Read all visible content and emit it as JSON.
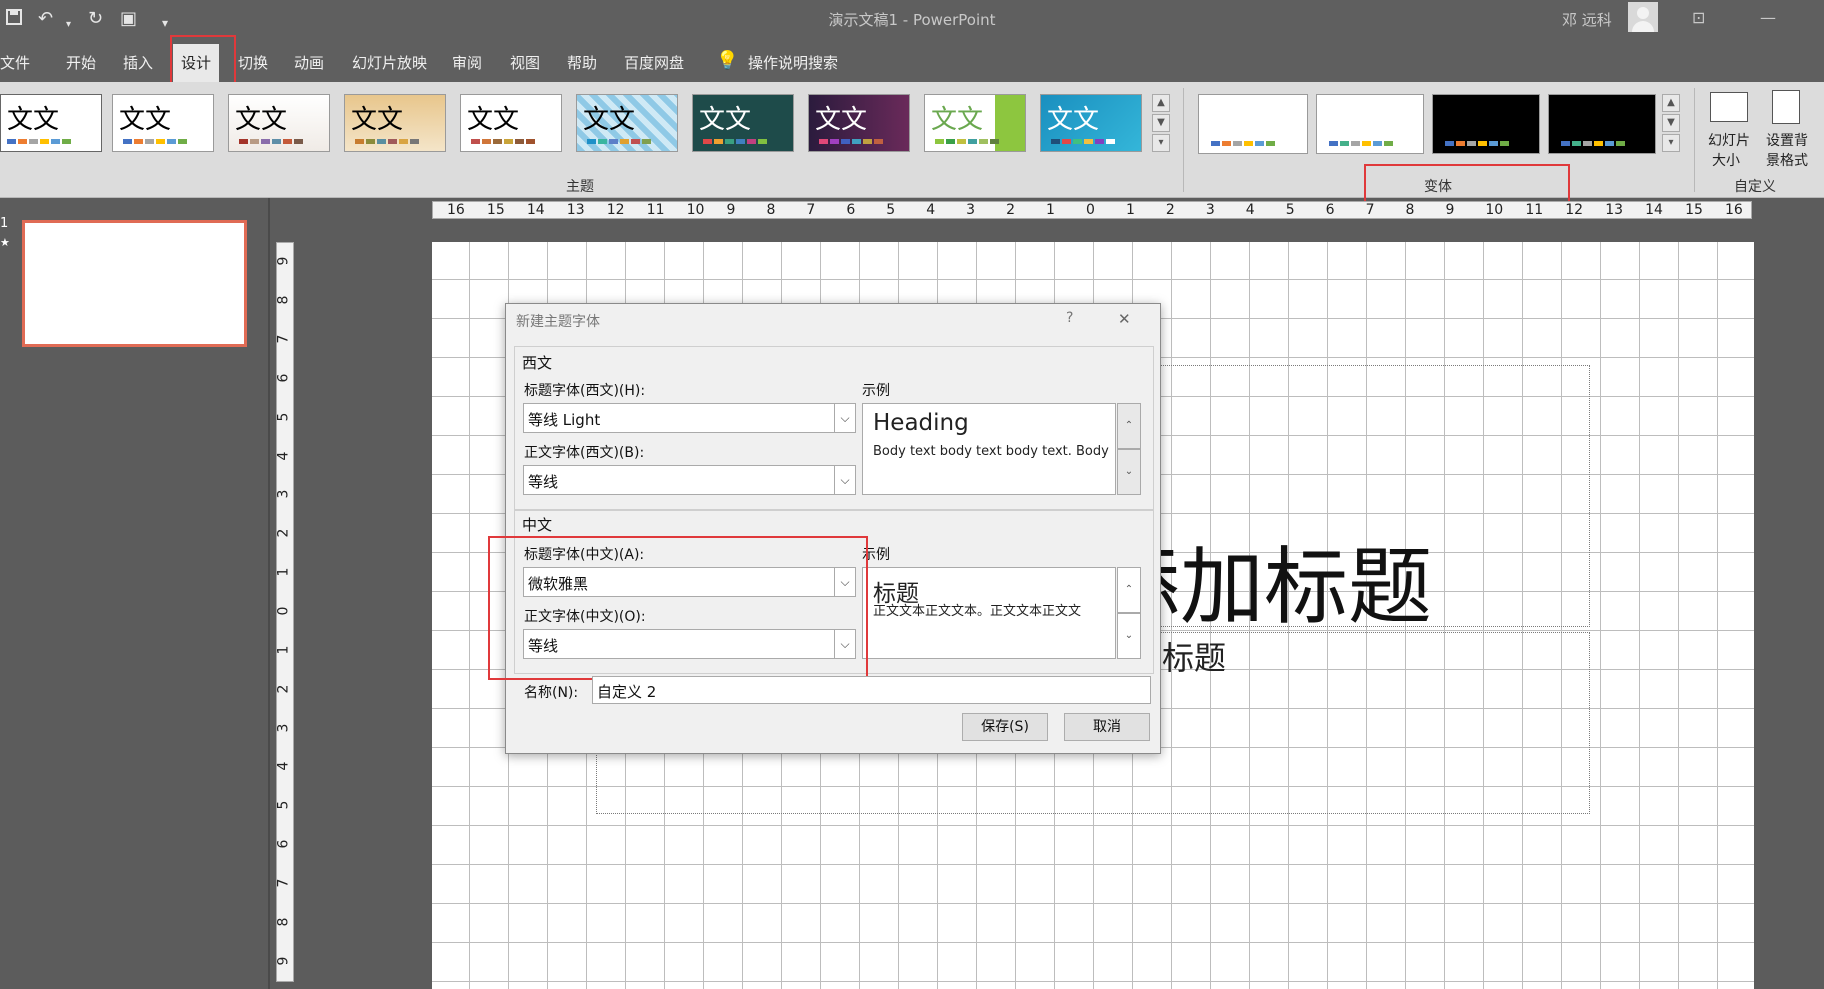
{
  "window": {
    "title": "演示文稿1  -  PowerPoint",
    "user_name": "邓 远科"
  },
  "menu": {
    "tabs": [
      "文件",
      "开始",
      "插入",
      "设计",
      "切换",
      "动画",
      "幻灯片放映",
      "审阅",
      "视图",
      "帮助",
      "百度网盘"
    ],
    "search_label": "操作说明搜索",
    "active": "设计"
  },
  "ribbon": {
    "themes_label": "主题",
    "variants_label": "变体",
    "customize_label": "自定义",
    "theme_sample_text": "文文",
    "slide_size_label_1": "幻灯片",
    "slide_size_label_2": "大小",
    "bg_format_label_1": "设置背",
    "bg_format_label_2": "景格式"
  },
  "ruler": {
    "horizontal": [
      "16",
      "15",
      "14",
      "13",
      "12",
      "11",
      "10",
      "9",
      "8",
      "7",
      "6",
      "5",
      "4",
      "3",
      "2",
      "1",
      "0",
      "1",
      "2",
      "3",
      "4",
      "5",
      "6",
      "7",
      "8",
      "9",
      "10",
      "11",
      "12",
      "13",
      "14",
      "15",
      "16"
    ],
    "vertical": [
      "9",
      "8",
      "7",
      "6",
      "5",
      "4",
      "3",
      "2",
      "1",
      "0",
      "1",
      "2",
      "3",
      "4",
      "5",
      "6",
      "7",
      "8",
      "9"
    ]
  },
  "slide": {
    "title_fragment": "添加标题",
    "subtitle_fragment": "副标题"
  },
  "dialog": {
    "title": "新建主题字体",
    "help": "?",
    "close": "✕",
    "western_section": "西文",
    "heading_font_western_label": "标题字体(西文)(H):",
    "heading_font_western_value": "等线 Light",
    "body_font_western_label": "正文字体(西文)(B):",
    "body_font_western_value": "等线",
    "sample_label": "示例",
    "western_sample_heading": "Heading",
    "western_sample_body": "Body text body text body text. Body",
    "chinese_section": "中文",
    "heading_font_chinese_label": "标题字体(中文)(A):",
    "heading_font_chinese_value": "微软雅黑",
    "body_font_chinese_label": "正文字体(中文)(O):",
    "body_font_chinese_value": "等线",
    "chinese_sample_heading": "标题",
    "chinese_sample_body": "正文文本正文文本。正文文本正文文",
    "name_label": "名称(N):",
    "name_value": "自定义 2",
    "save_button": "保存(S)",
    "cancel_button": "取消"
  }
}
